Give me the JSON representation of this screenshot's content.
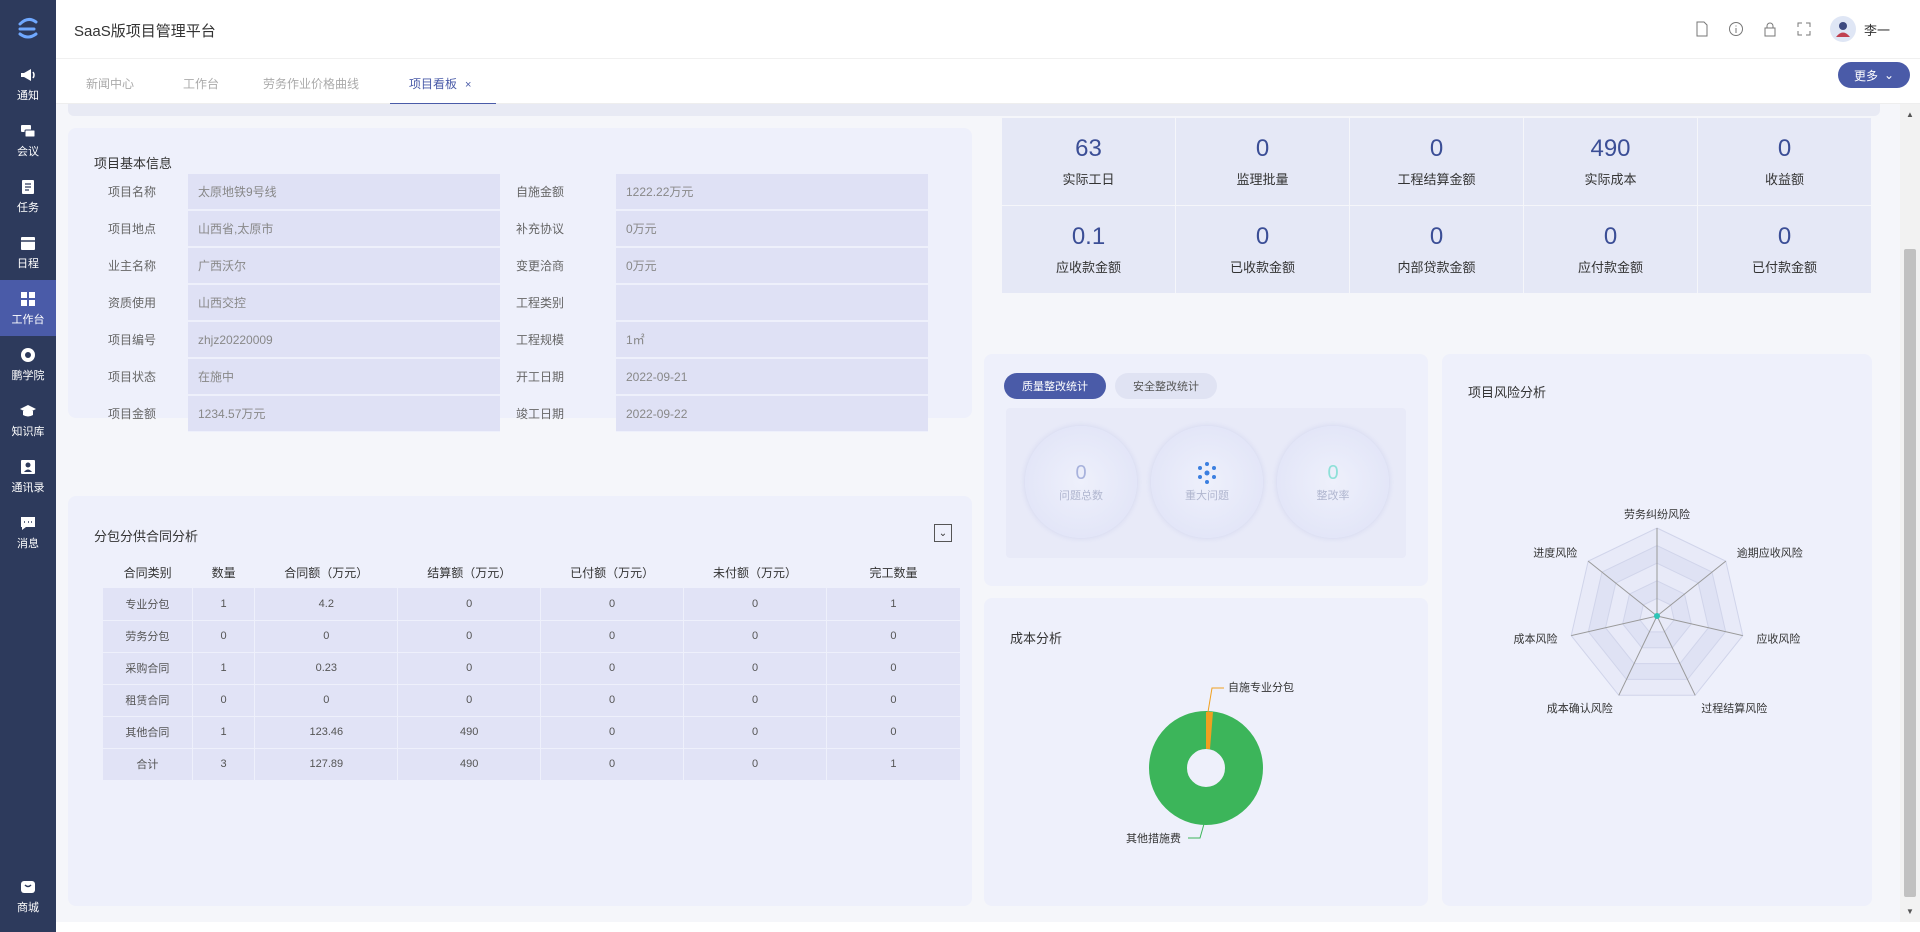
{
  "sidebar": {
    "items": [
      {
        "label": "通知",
        "icon": "megaphone-icon"
      },
      {
        "label": "会议",
        "icon": "meeting-icon"
      },
      {
        "label": "任务",
        "icon": "task-icon"
      },
      {
        "label": "日程",
        "icon": "calendar-icon"
      },
      {
        "label": "工作台",
        "icon": "grid-icon"
      },
      {
        "label": "鹏学院",
        "icon": "academy-icon"
      },
      {
        "label": "知识库",
        "icon": "graduation-cap-icon"
      },
      {
        "label": "通讯录",
        "icon": "contacts-icon"
      },
      {
        "label": "消息",
        "icon": "chat-icon"
      }
    ],
    "bottom": {
      "label": "商城",
      "icon": "shop-icon"
    }
  },
  "header": {
    "title": "SaaS版项目管理平台",
    "user": "李一"
  },
  "tabs": [
    {
      "label": "新闻中心"
    },
    {
      "label": "工作台"
    },
    {
      "label": "劳务作业价格曲线"
    },
    {
      "label": "项目看板"
    }
  ],
  "more_label": "更多",
  "basic_info": {
    "title": "项目基本信息",
    "rows": [
      {
        "l1": "项目名称",
        "v1": "太原地铁9号线",
        "l2": "自施金额",
        "v2": "1222.22万元"
      },
      {
        "l1": "项目地点",
        "v1": "山西省,太原市",
        "l2": "补充协议",
        "v2": "0万元"
      },
      {
        "l1": "业主名称",
        "v1": "广西沃尔",
        "l2": "变更洽商",
        "v2": "0万元"
      },
      {
        "l1": "资质使用",
        "v1": "山西交控",
        "l2": "工程类别",
        "v2": ""
      },
      {
        "l1": "项目编号",
        "v1": "zhjz20220009",
        "l2": "工程规模",
        "v2": "1㎡"
      },
      {
        "l1": "项目状态",
        "v1": "在施中",
        "l2": "开工日期",
        "v2": "2022-09-21"
      },
      {
        "l1": "项目金额",
        "v1": "1234.57万元",
        "l2": "竣工日期",
        "v2": "2022-09-22"
      }
    ]
  },
  "metrics": [
    {
      "value": "63",
      "label": "实际工日"
    },
    {
      "value": "0",
      "label": "监理批量"
    },
    {
      "value": "0",
      "label": "工程结算金额"
    },
    {
      "value": "490",
      "label": "实际成本"
    },
    {
      "value": "0",
      "label": "收益额"
    },
    {
      "value": "0.1",
      "label": "应收款金额"
    },
    {
      "value": "0",
      "label": "已收款金额"
    },
    {
      "value": "0",
      "label": "内部贷款金额"
    },
    {
      "value": "0",
      "label": "应付款金额"
    },
    {
      "value": "0",
      "label": "已付款金额"
    }
  ],
  "contract": {
    "title": "分包分供合同分析",
    "headers": [
      "合同类别",
      "数量",
      "合同额（万元）",
      "结算额（万元）",
      "已付额（万元）",
      "未付额（万元）",
      "完工数量"
    ],
    "rows": [
      [
        "专业分包",
        "1",
        "4.2",
        "0",
        "0",
        "0",
        "1"
      ],
      [
        "劳务分包",
        "0",
        "0",
        "0",
        "0",
        "0",
        "0"
      ],
      [
        "采购合同",
        "1",
        "0.23",
        "0",
        "0",
        "0",
        "0"
      ],
      [
        "租赁合同",
        "0",
        "0",
        "0",
        "0",
        "0",
        "0"
      ],
      [
        "其他合同",
        "1",
        "123.46",
        "490",
        "0",
        "0",
        "0"
      ],
      [
        "合计",
        "3",
        "127.89",
        "490",
        "0",
        "0",
        "1"
      ]
    ]
  },
  "quality": {
    "tab_active": "质量整改统计",
    "tab_inactive": "安全整改统计",
    "circles": [
      {
        "value": "0",
        "label": "问题总数"
      },
      {
        "value": "",
        "label": "重大问题"
      },
      {
        "value": "0",
        "label": "整改率"
      }
    ]
  },
  "cost": {
    "title": "成本分析",
    "labels": [
      "自施专业分包",
      "其他措施费"
    ]
  },
  "risk": {
    "title": "项目风险分析",
    "axes": [
      "劳务纠纷风险",
      "逾期应收风险",
      "应收风险",
      "过程结算风险",
      "成本确认风险",
      "成本风险",
      "进度风险"
    ]
  },
  "colors": {
    "sidebar": "#2d3a5c",
    "accent": "#4a5ba8",
    "donut": "#3cb55a",
    "donut_small": "#f0a020"
  }
}
